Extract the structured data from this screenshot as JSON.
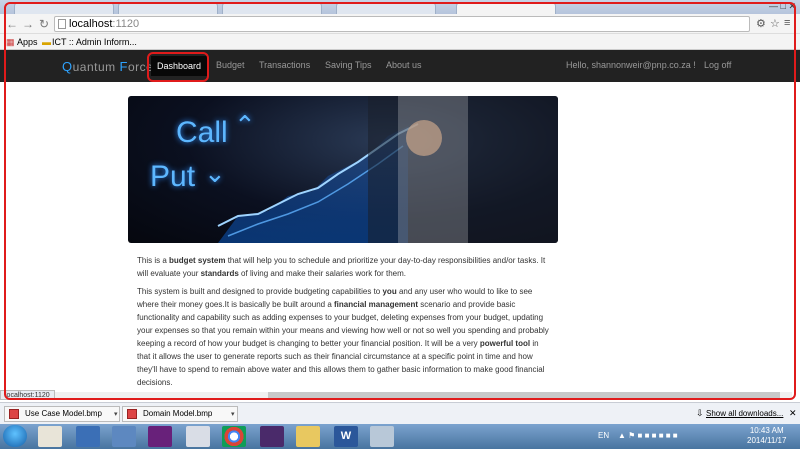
{
  "browser": {
    "address": {
      "host": "localhost",
      "port": ":1120"
    },
    "bookmarks": [
      {
        "label": "Apps"
      },
      {
        "label": "ICT :: Admin Inform..."
      }
    ]
  },
  "navbar": {
    "brand_q": "Q",
    "brand_rest": "uantum ",
    "brand_f": "F",
    "brand_rest2": "orce",
    "links": [
      {
        "label": "Dashboard"
      },
      {
        "label": "Budget"
      },
      {
        "label": "Transactions"
      },
      {
        "label": "Saving Tips"
      },
      {
        "label": "About us"
      }
    ],
    "greeting": "Hello, shannonweir@pnp.co.za !",
    "logoff": "Log off"
  },
  "hero": {
    "call": "Call",
    "put": "Put"
  },
  "content": {
    "p1_a": "This is a ",
    "p1_b": "budget system",
    "p1_c": " that will help you to schedule and prioritize your day-to-day responsibilities and/or tasks. It will evaluate your ",
    "p1_d": "standards",
    "p1_e": " of living and make their salaries work for them.",
    "p2_a": "This system is built and designed to provide budgeting capabilities to ",
    "p2_b": "you",
    "p2_c": " and any user who would to like to see where their money goes.It is basically be built around a ",
    "p2_d": "financial management",
    "p2_e": " scenario and provide basic functionality and capability such as adding expenses to your budget, deleting expenses from your budget, updating your expenses so that you remain within your means and viewing how well or not so well you spending and probably keeping a record of how your budget is changing to better your financial position. It will be a very ",
    "p2_f": "powerful tool",
    "p2_g": " in that it allows the user to generate reports such as their financial circumstance at a specific point in time and how they'll have to spend to remain above water and this allows them to gather basic information to make good financial decisions."
  },
  "status_url": "localhost:1120",
  "downloads": {
    "items": [
      {
        "label": "Use Case Model.bmp"
      },
      {
        "label": "Domain Model.bmp"
      }
    ],
    "show_all": "Show all downloads..."
  },
  "taskbar": {
    "lang": "EN",
    "time": "10:43 AM",
    "date": "2014/11/17"
  }
}
